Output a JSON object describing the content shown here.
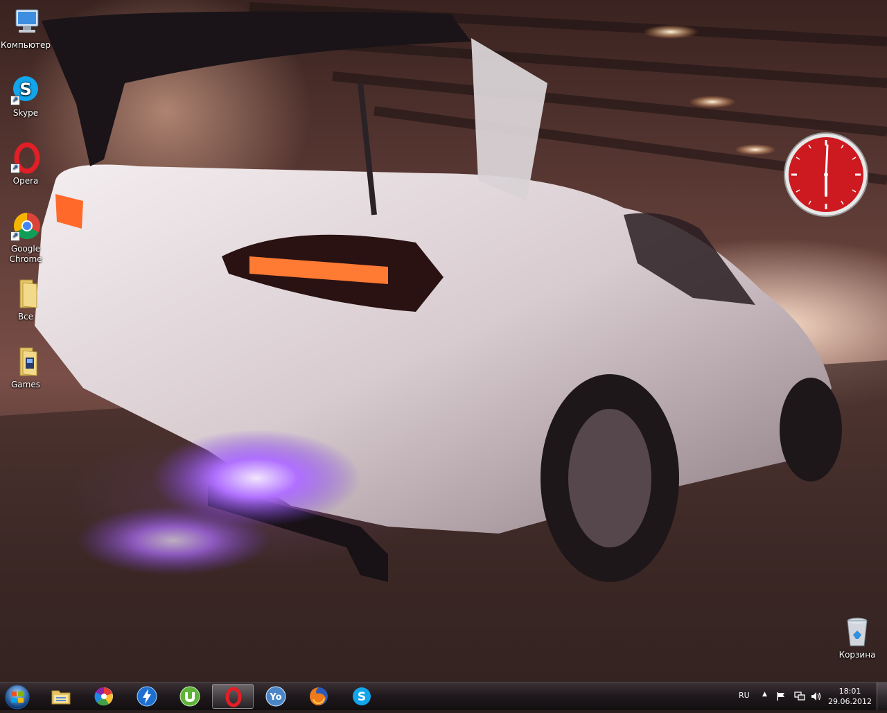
{
  "desktop": {
    "icons": [
      {
        "label": "Компьютер",
        "icon": "computer-icon"
      },
      {
        "label": "Skype",
        "icon": "skype-icon"
      },
      {
        "label": "Opera",
        "icon": "opera-icon"
      },
      {
        "label": "Google Chrome",
        "icon": "chrome-icon"
      },
      {
        "label": "Все",
        "icon": "folder-icon"
      },
      {
        "label": "Games",
        "icon": "games-folder-icon"
      }
    ],
    "recycle_bin": {
      "label": "Корзина",
      "icon": "recycle-bin-icon"
    }
  },
  "gadget": {
    "clock_face_color": "#c8191e"
  },
  "taskbar": {
    "pinned": [
      {
        "name": "explorer",
        "icon": "file-explorer-icon"
      },
      {
        "name": "picasa",
        "icon": "picasa-icon"
      },
      {
        "name": "download-master",
        "icon": "lightning-icon"
      },
      {
        "name": "utorrent",
        "icon": "utorrent-icon"
      },
      {
        "name": "opera",
        "icon": "opera-icon",
        "active": true
      },
      {
        "name": "yandex-online",
        "icon": "yo-icon"
      },
      {
        "name": "firefox",
        "icon": "firefox-icon"
      },
      {
        "name": "skype",
        "icon": "skype-icon"
      }
    ],
    "tray": {
      "language": "RU",
      "time": "18:01",
      "date": "29.06.2012"
    }
  }
}
